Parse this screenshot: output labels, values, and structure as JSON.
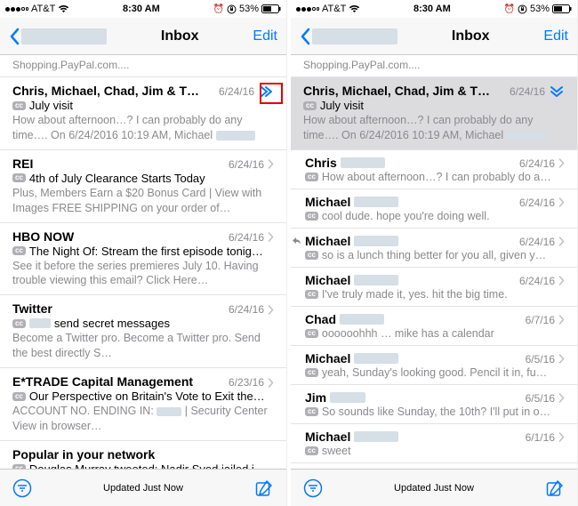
{
  "status": {
    "carrier": "AT&T",
    "time": "8:30 AM",
    "battery_pct": "53%"
  },
  "nav": {
    "title": "Inbox",
    "edit": "Edit"
  },
  "prev_snippet": "Shopping.PayPal.com....",
  "left": {
    "rows": [
      {
        "sender": "Chris, Michael, Chad, Jim & T…",
        "date": "6/24/16",
        "cc": true,
        "subject": "July visit",
        "preview": "How about afternoon…? I can probably do any time…. On 6/24/2016 10:19 AM, Michael",
        "thread": true,
        "sender_blur_w": 0
      },
      {
        "sender": "REI",
        "date": "6/24/16",
        "cc": true,
        "subject": "4th of July Clearance Starts Today",
        "preview": "Plus, Members Earn a $20 Bonus Card | View with Images FREE SHIPPING on your order of…"
      },
      {
        "sender": "HBO NOW",
        "date": "6/24/16",
        "cc": true,
        "subject": "The Night Of: Stream the first episode tonig…",
        "preview": "See it before the series premieres July 10. Having trouble viewing this email? Click Here…"
      },
      {
        "sender": "Twitter",
        "date": "6/24/16",
        "cc": true,
        "subject_prefix_blur": 24,
        "subject": "send secret messages",
        "preview": "Become a Twitter pro. Become a Twitter pro. Send the best directly S…"
      },
      {
        "sender": "E*TRADE Capital Management",
        "date": "6/23/16",
        "cc": true,
        "subject": "Our Perspective on Britain's Vote to Exit the…",
        "preview_parts": [
          "ACCOUNT NO. ENDING IN: ",
          " | Security Center View in browser…"
        ],
        "preview_blur_w": 28
      },
      {
        "sender": "Popular in your network",
        "date": "",
        "cc": true,
        "subject": "Douglas Murray tweeted: Nadir Syed jailed i…",
        "preview": ""
      }
    ]
  },
  "right": {
    "header": {
      "sender": "Chris, Michael, Chad, Jim & T…",
      "date": "6/24/16",
      "cc": true,
      "subject": "July visit",
      "preview": "How about afternoon…? I can probably do any time…. On 6/24/2016 10:19 AM, Michael"
    },
    "thread": [
      {
        "sender": "Chris",
        "blur_w": 50,
        "date": "6/24/16",
        "cc": true,
        "msg": "How about afternoon…? I can probably do a…"
      },
      {
        "sender": "Michael",
        "blur_w": 50,
        "date": "6/24/16",
        "cc": true,
        "msg": "cool dude. hope you're doing well."
      },
      {
        "sender": "Michael",
        "blur_w": 50,
        "date": "6/24/16",
        "cc": true,
        "msg": "so is a lunch thing better for you all, given y…",
        "reply": true
      },
      {
        "sender": "Michael",
        "blur_w": 50,
        "date": "6/24/16",
        "cc": true,
        "msg": "I've truly made it, yes. hit the big time."
      },
      {
        "sender": "Chad",
        "blur_w": 50,
        "date": "6/7/16",
        "cc": true,
        "msg": "oooooohhh … mike has a calendar"
      },
      {
        "sender": "Michael",
        "blur_w": 50,
        "date": "6/5/16",
        "cc": true,
        "msg": "yeah, Sunday's looking good. Pencil it in, fu…"
      },
      {
        "sender": "Jim",
        "blur_w": 40,
        "date": "6/5/16",
        "cc": true,
        "msg": "So sounds like Sunday, the 10th? I'll put in o…"
      },
      {
        "sender": "Michael",
        "blur_w": 50,
        "date": "6/1/16",
        "cc": true,
        "msg": "sweet"
      }
    ]
  },
  "toolbar": {
    "status": "Updated Just Now"
  },
  "icons": {
    "alarm": "⏰",
    "orientation_lock": "🔒"
  }
}
